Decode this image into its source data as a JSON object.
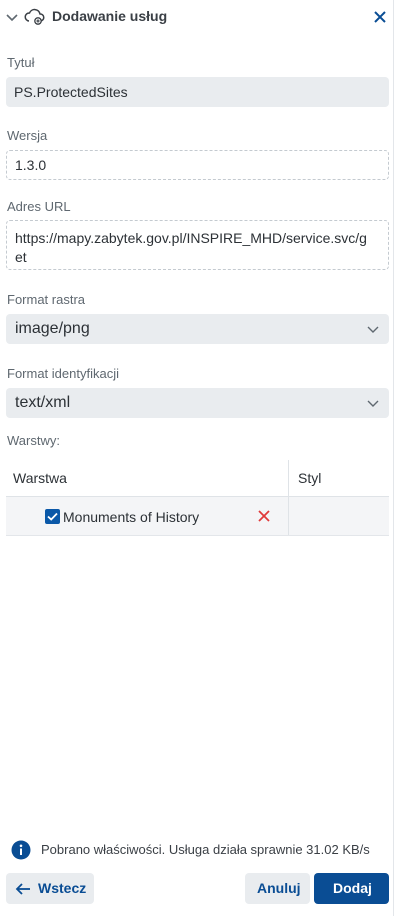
{
  "header": {
    "title": "Dodawanie usług"
  },
  "form": {
    "title_label": "Tytuł",
    "title_value": "PS.ProtectedSites",
    "version_label": "Wersja",
    "version_value": "1.3.0",
    "url_label": "Adres URL",
    "url_value_line1": "https://mapy.zabytek.gov.pl/INSPIRE_MHD/service.svc/g",
    "url_value_line2": "et",
    "raster_label": "Format rastra",
    "raster_value": "image/png",
    "ident_label": "Format identyfikacji",
    "ident_value": "text/xml",
    "layers_label": "Warstwy:"
  },
  "table": {
    "col_layer": "Warstwa",
    "col_style": "Styl",
    "rows": [
      {
        "label": "Monuments of History",
        "checked": true
      }
    ]
  },
  "status": {
    "text": "Pobrano właściwości. Usługa działa sprawnie 31.02 KB/s"
  },
  "buttons": {
    "back": "Wstecz",
    "cancel": "Anuluj",
    "add": "Dodaj"
  },
  "colors": {
    "accent": "#0a4d94",
    "remove": "#e03a3a",
    "field_bg": "#e9ecef"
  }
}
